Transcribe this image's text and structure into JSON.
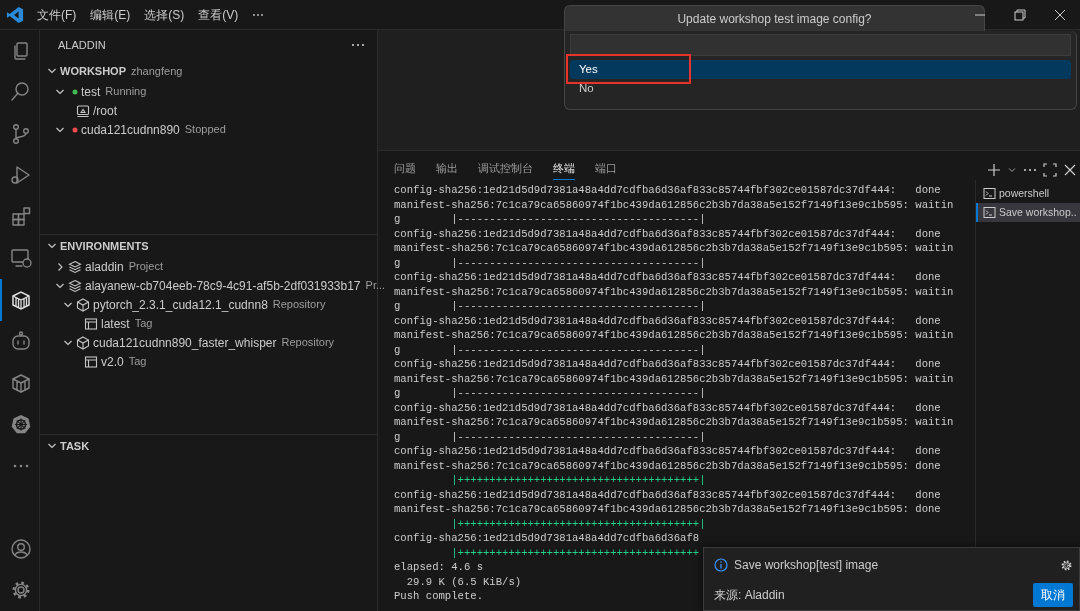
{
  "title_bar": {
    "menus": [
      "文件(F)",
      "编辑(E)",
      "选择(S)",
      "查看(V)",
      "⋯"
    ]
  },
  "activity_bar": {
    "items": [
      {
        "kind": "files",
        "selected": false
      },
      {
        "kind": "search",
        "selected": false
      },
      {
        "kind": "source-control",
        "selected": false
      },
      {
        "kind": "run-debug",
        "selected": false
      },
      {
        "kind": "extensions",
        "selected": false
      },
      {
        "kind": "remote",
        "selected": false
      },
      {
        "kind": "aladdin",
        "selected": true
      },
      {
        "kind": "robot",
        "selected": false
      },
      {
        "kind": "container",
        "selected": false
      },
      {
        "kind": "helm",
        "selected": false
      },
      {
        "kind": "more",
        "selected": false
      }
    ],
    "bottom_items": [
      {
        "kind": "account",
        "selected": false
      },
      {
        "kind": "settings",
        "selected": false
      }
    ]
  },
  "sidebar": {
    "title": "ALADDIN",
    "sections": [
      {
        "title": "WORKSHOP",
        "description": "zhangfeng",
        "expanded": true,
        "items": [
          {
            "kind": "status",
            "label": "test",
            "description": "Running",
            "color": "#3fb950",
            "expanded": true,
            "children": [
              {
                "kind": "folder",
                "label": "/root"
              }
            ]
          },
          {
            "kind": "status",
            "label": "cuda121cudnn890",
            "description": "Stopped",
            "color": "#f14c4c",
            "expanded": true
          }
        ]
      },
      {
        "title": "ENVIRONMENTS",
        "expanded": true,
        "items": [
          {
            "kind": "project",
            "label": "aladdin",
            "description": "Project",
            "expanded": false
          },
          {
            "kind": "project",
            "label": "alayanew-cb704eeb-78c9-4c91-af5b-2df031933b17",
            "description": "Pr...",
            "expanded": true,
            "children": [
              {
                "kind": "repository",
                "label": "pytorch_2.3.1_cuda12.1_cudnn8",
                "description": "Repository",
                "expanded": true,
                "children": [
                  {
                    "kind": "tag",
                    "label": "latest",
                    "description": "Tag"
                  }
                ]
              },
              {
                "kind": "repository",
                "label": "cuda121cudnn890_faster_whisper",
                "description": "Repository",
                "expanded": true,
                "children": [
                  {
                    "kind": "tag",
                    "label": "v2.0",
                    "description": "Tag"
                  }
                ]
              }
            ]
          }
        ]
      },
      {
        "title": "TASK",
        "expanded": true
      }
    ]
  },
  "quick_pick": {
    "title": "Update workshop test image config?",
    "options": [
      {
        "label": "Yes",
        "selected": true,
        "highlighted": true
      },
      {
        "label": "No",
        "selected": false,
        "highlighted": false
      }
    ]
  },
  "panel": {
    "tabs": [
      {
        "label": "问题",
        "selected": false
      },
      {
        "label": "输出",
        "selected": false
      },
      {
        "label": "调试控制台",
        "selected": false
      },
      {
        "label": "终端",
        "selected": true
      },
      {
        "label": "端口",
        "selected": false
      }
    ],
    "terminal": {
      "lines": [
        {
          "kind": "output",
          "text": "config-sha256:1ed21d5d9d7381a48a4dd7cdfba6d36af833c85744fbf302ce01587dc37df444:   done"
        },
        {
          "kind": "output",
          "text": "manifest-sha256:7c1ca79ca65860974f1bc439da612856c2b3b7da38a5e152f7149f13e9c1b595: waitin"
        },
        {
          "kind": "output",
          "text": "g        |--------------------------------------|"
        },
        {
          "kind": "output",
          "text": "config-sha256:1ed21d5d9d7381a48a4dd7cdfba6d36af833c85744fbf302ce01587dc37df444:   done"
        },
        {
          "kind": "output",
          "text": "manifest-sha256:7c1ca79ca65860974f1bc439da612856c2b3b7da38a5e152f7149f13e9c1b595: waitin"
        },
        {
          "kind": "output",
          "text": "g        |--------------------------------------|"
        },
        {
          "kind": "output",
          "text": "config-sha256:1ed21d5d9d7381a48a4dd7cdfba6d36af833c85744fbf302ce01587dc37df444:   done"
        },
        {
          "kind": "output",
          "text": "manifest-sha256:7c1ca79ca65860974f1bc439da612856c2b3b7da38a5e152f7149f13e9c1b595: waitin"
        },
        {
          "kind": "output",
          "text": "g        |--------------------------------------|"
        },
        {
          "kind": "output",
          "text": "config-sha256:1ed21d5d9d7381a48a4dd7cdfba6d36af833c85744fbf302ce01587dc37df444:   done"
        },
        {
          "kind": "output",
          "text": "manifest-sha256:7c1ca79ca65860974f1bc439da612856c2b3b7da38a5e152f7149f13e9c1b595: waitin"
        },
        {
          "kind": "output",
          "text": "g        |--------------------------------------|"
        },
        {
          "kind": "output",
          "text": "config-sha256:1ed21d5d9d7381a48a4dd7cdfba6d36af833c85744fbf302ce01587dc37df444:   done"
        },
        {
          "kind": "output",
          "text": "manifest-sha256:7c1ca79ca65860974f1bc439da612856c2b3b7da38a5e152f7149f13e9c1b595: waitin"
        },
        {
          "kind": "output",
          "text": "g        |--------------------------------------|"
        },
        {
          "kind": "output",
          "text": "config-sha256:1ed21d5d9d7381a48a4dd7cdfba6d36af833c85744fbf302ce01587dc37df444:   done"
        },
        {
          "kind": "output",
          "text": "manifest-sha256:7c1ca79ca65860974f1bc439da612856c2b3b7da38a5e152f7149f13e9c1b595: waitin"
        },
        {
          "kind": "output",
          "text": "g        |--------------------------------------|"
        },
        {
          "kind": "output",
          "text": "config-sha256:1ed21d5d9d7381a48a4dd7cdfba6d36af833c85744fbf302ce01587dc37df444:   done"
        },
        {
          "kind": "output",
          "text": "manifest-sha256:7c1ca79ca65860974f1bc439da612856c2b3b7da38a5e152f7149f13e9c1b595: done"
        },
        {
          "kind": "progress",
          "text": "         |++++++++++++++++++++++++++++++++++++++|"
        },
        {
          "kind": "output",
          "text": "config-sha256:1ed21d5d9d7381a48a4dd7cdfba6d36af833c85744fbf302ce01587dc37df444:   done"
        },
        {
          "kind": "output",
          "text": "manifest-sha256:7c1ca79ca65860974f1bc439da612856c2b3b7da38a5e152f7149f13e9c1b595: done"
        },
        {
          "kind": "progress",
          "text": "         |++++++++++++++++++++++++++++++++++++++|"
        },
        {
          "kind": "output",
          "text": "config-sha256:1ed21d5d9d7381a48a4dd7cdfba6d36af8"
        },
        {
          "kind": "progress",
          "text": "         |++++++++++++++++++++++++++++++++++++++"
        },
        {
          "kind": "output",
          "text": "elapsed: 4.6 s"
        },
        {
          "kind": "output",
          "text": "  29.9 K (6.5 KiB/s)"
        },
        {
          "kind": "output",
          "text": "Push complete."
        }
      ]
    },
    "terminal_list": [
      {
        "label": "powershell",
        "selected": false
      },
      {
        "label": "Save workshop..",
        "selected": true
      }
    ]
  },
  "notification": {
    "message": "Save workshop[test] image",
    "source": "来源: Aladdin",
    "button": "取消"
  }
}
